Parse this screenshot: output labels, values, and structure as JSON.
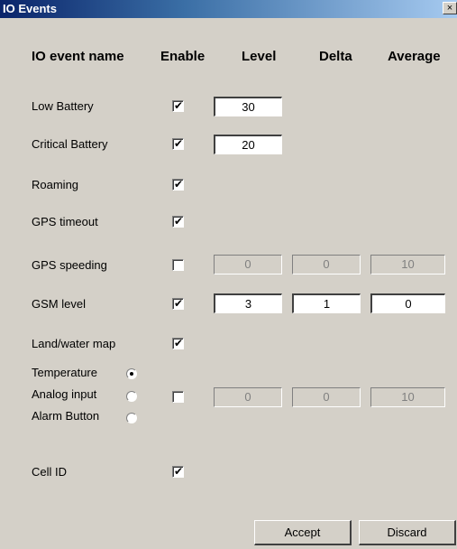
{
  "window": {
    "title": "IO Events",
    "close_label": "×"
  },
  "headers": {
    "name": "IO event name",
    "enable": "Enable",
    "level": "Level",
    "delta": "Delta",
    "average": "Average"
  },
  "rows": {
    "low_battery": {
      "label": "Low Battery",
      "enabled": true,
      "level": "30"
    },
    "critical_battery": {
      "label": "Critical Battery",
      "enabled": true,
      "level": "20"
    },
    "roaming": {
      "label": "Roaming",
      "enabled": true
    },
    "gps_timeout": {
      "label": "GPS timeout",
      "enabled": true
    },
    "gps_speeding": {
      "label": "GPS speeding",
      "enabled": false,
      "level": "0",
      "delta": "0",
      "average": "10"
    },
    "gsm_level": {
      "label": "GSM level",
      "enabled": true,
      "level": "3",
      "delta": "1",
      "average": "0"
    },
    "land_water_map": {
      "label": "Land/water map",
      "enabled": true
    },
    "analog": {
      "enabled": false,
      "level": "0",
      "delta": "0",
      "average": "10",
      "options": [
        {
          "label": "Temperature",
          "selected": true
        },
        {
          "label": "Analog input",
          "selected": false
        },
        {
          "label": "Alarm Button",
          "selected": false
        }
      ]
    },
    "cell_id": {
      "label": "Cell ID",
      "enabled": true
    }
  },
  "buttons": {
    "accept": "Accept",
    "discard": "Discard"
  },
  "check_glyph": "✔"
}
